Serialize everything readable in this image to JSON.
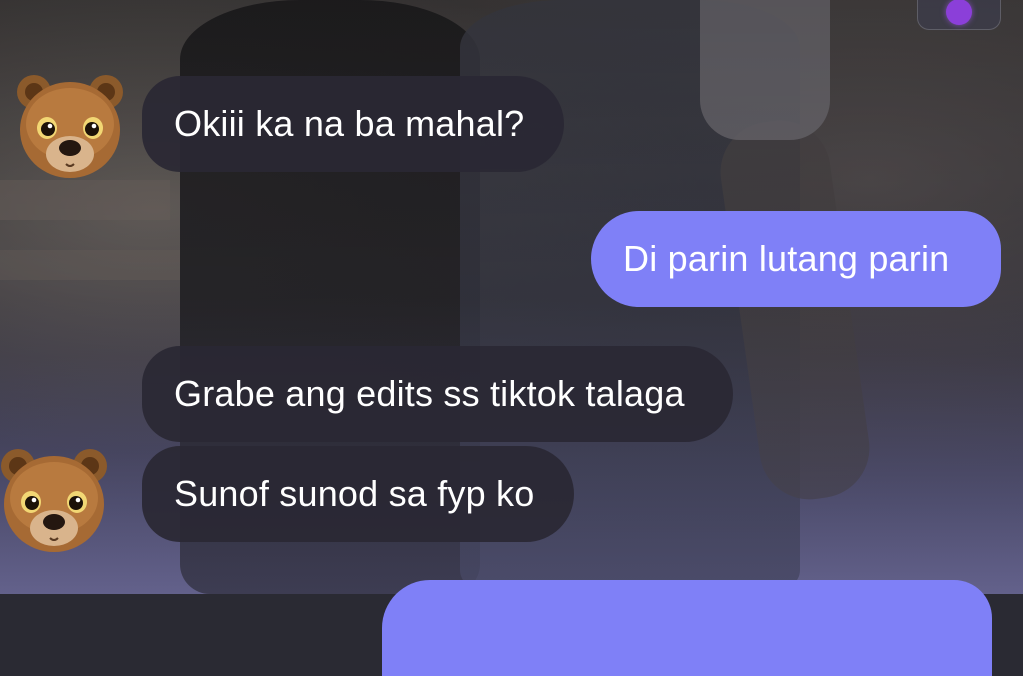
{
  "chat": {
    "messages": [
      {
        "sender": "bot",
        "text": "Okiii ka na ba mahal?"
      },
      {
        "sender": "user",
        "text": "Di parin lutang parin"
      },
      {
        "sender": "bot",
        "text": "Grabe ang edits ss tiktok talaga"
      },
      {
        "sender": "bot",
        "text": "Sunof sunod sa fyp ko"
      },
      {
        "sender": "user",
        "text": ""
      }
    ],
    "avatar_icon": "bear-face-icon",
    "top_button_icon": "purple-gem-icon"
  },
  "colors": {
    "incoming_bubble": "#2a2834",
    "outgoing_bubble": "#7f80f7",
    "text": "#ffffff",
    "gem": "#8b3fd9"
  }
}
